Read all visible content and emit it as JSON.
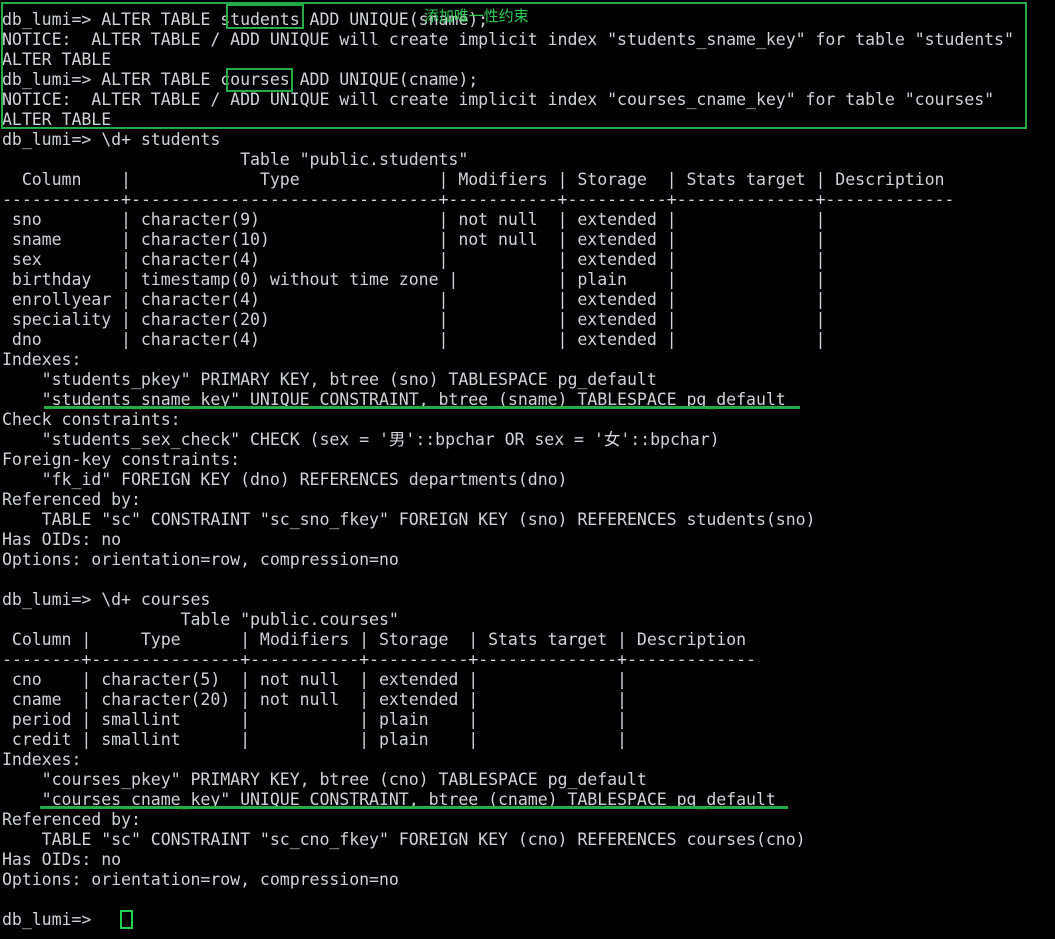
{
  "terminal": {
    "prompt": "db_lumi=>",
    "fg_color": "#cfd3d8",
    "bg_color": "#000000",
    "annotation_color": "#23ab46",
    "note_color": "#2ecc57",
    "cursor_color": "#23d34f"
  },
  "annotations": {
    "note_text": "添加唯一性约束",
    "boxed_words": [
      "students",
      "courses"
    ],
    "underlined_lines": [
      "\"students_sname_key\" UNIQUE CONSTRAINT, btree (sname) TABLESPACE pg_default",
      "\"courses_cname_key\" UNIQUE CONSTRAINT, btree (cname) TABLESPACE pg_default"
    ]
  },
  "lines": [
    "db_lumi=> ALTER TABLE students ADD UNIQUE(sname);",
    "NOTICE:  ALTER TABLE / ADD UNIQUE will create implicit index \"students_sname_key\" for table \"students\"",
    "ALTER TABLE",
    "db_lumi=> ALTER TABLE courses ADD UNIQUE(cname);",
    "NOTICE:  ALTER TABLE / ADD UNIQUE will create implicit index \"courses_cname_key\" for table \"courses\"",
    "ALTER TABLE",
    "db_lumi=> \\d+ students",
    "                        Table \"public.students\"",
    "  Column    |             Type              | Modifiers | Storage  | Stats target | Description",
    "------------+-------------------------------+-----------+----------+--------------+-------------",
    " sno        | character(9)                  | not null  | extended |              |",
    " sname      | character(10)                 | not null  | extended |              |",
    " sex        | character(4)                  |           | extended |              |",
    " birthday   | timestamp(0) without time zone |          | plain    |              |",
    " enrollyear | character(4)                  |           | extended |              |",
    " speciality | character(20)                 |           | extended |              |",
    " dno        | character(4)                  |           | extended |              |",
    "Indexes:",
    "    \"students_pkey\" PRIMARY KEY, btree (sno) TABLESPACE pg_default",
    "    \"students_sname_key\" UNIQUE CONSTRAINT, btree (sname) TABLESPACE pg_default",
    "Check constraints:",
    "    \"students_sex_check\" CHECK (sex = '男'::bpchar OR sex = '女'::bpchar)",
    "Foreign-key constraints:",
    "    \"fk_id\" FOREIGN KEY (dno) REFERENCES departments(dno)",
    "Referenced by:",
    "    TABLE \"sc\" CONSTRAINT \"sc_sno_fkey\" FOREIGN KEY (sno) REFERENCES students(sno)",
    "Has OIDs: no",
    "Options: orientation=row, compression=no",
    "",
    "db_lumi=> \\d+ courses",
    "                  Table \"public.courses\"",
    " Column |     Type      | Modifiers | Storage  | Stats target | Description",
    "--------+---------------+-----------+----------+--------------+-------------",
    " cno    | character(5)  | not null  | extended |              |",
    " cname  | character(20) | not null  | extended |              |",
    " period | smallint      |           | plain    |              |",
    " credit | smallint      |           | plain    |              |",
    "Indexes:",
    "    \"courses_pkey\" PRIMARY KEY, btree (cno) TABLESPACE pg_default",
    "    \"courses_cname_key\" UNIQUE CONSTRAINT, btree (cname) TABLESPACE pg_default",
    "Referenced by:",
    "    TABLE \"sc\" CONSTRAINT \"sc_cno_fkey\" FOREIGN KEY (cno) REFERENCES courses(cno)",
    "Has OIDs: no",
    "Options: orientation=row, compression=no",
    "",
    "db_lumi=>"
  ]
}
